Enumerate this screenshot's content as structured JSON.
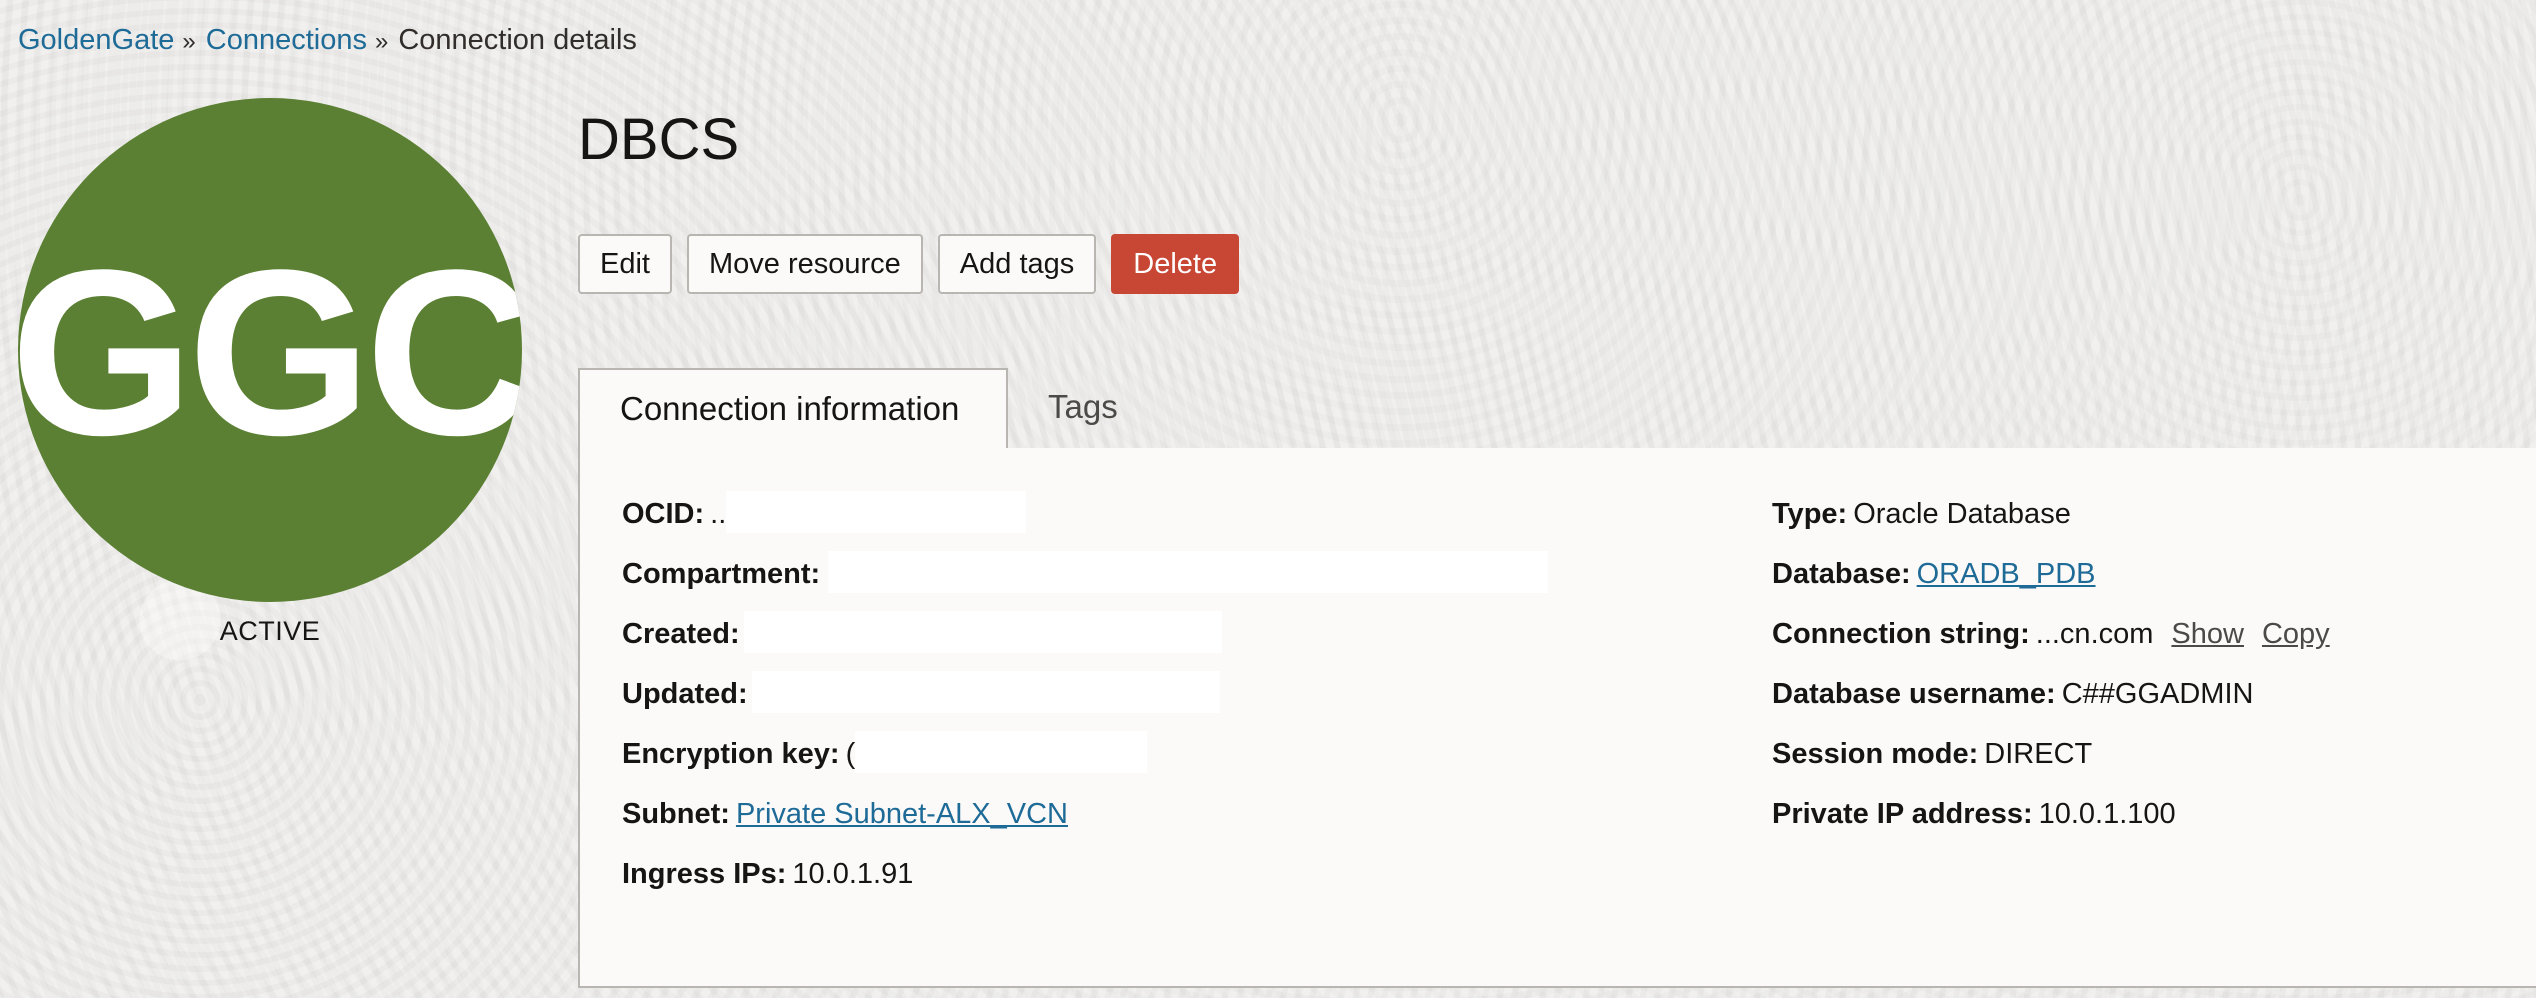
{
  "breadcrumb": {
    "items": [
      "GoldenGate",
      "Connections"
    ],
    "separator": "»",
    "current": "Connection details"
  },
  "logo": {
    "text": "GGC",
    "color": "#5b8033"
  },
  "status": "ACTIVE",
  "title": "DBCS",
  "actions": {
    "edit": "Edit",
    "move": "Move resource",
    "add_tags": "Add tags",
    "delete": "Delete",
    "delete_color": "#c74634"
  },
  "tabs": [
    "Connection information",
    "Tags"
  ],
  "left_fields": {
    "ocid": {
      "label": "OCID:",
      "value": ".."
    },
    "compartment": {
      "label": "Compartment:"
    },
    "created": {
      "label": "Created:"
    },
    "updated": {
      "label": "Updated:"
    },
    "encryption": {
      "label": "Encryption key:",
      "value": "("
    },
    "subnet": {
      "label": "Subnet:",
      "value": "Private Subnet-ALX_VCN"
    },
    "ingress": {
      "label": "Ingress IPs:",
      "value": "10.0.1.91"
    }
  },
  "right_fields": {
    "type": {
      "label": "Type:",
      "value": "Oracle Database"
    },
    "database": {
      "label": "Database:",
      "value": "ORADB_PDB"
    },
    "connection_string": {
      "label": "Connection string:",
      "value": "...cn.com",
      "show": "Show",
      "copy": "Copy"
    },
    "db_username": {
      "label": "Database username:",
      "value": "C##GGADMIN"
    },
    "session_mode": {
      "label": "Session mode:",
      "value": "DIRECT"
    },
    "private_ip": {
      "label": "Private IP address:",
      "value": "10.0.1.100"
    }
  },
  "link_color": "#1f6b98"
}
